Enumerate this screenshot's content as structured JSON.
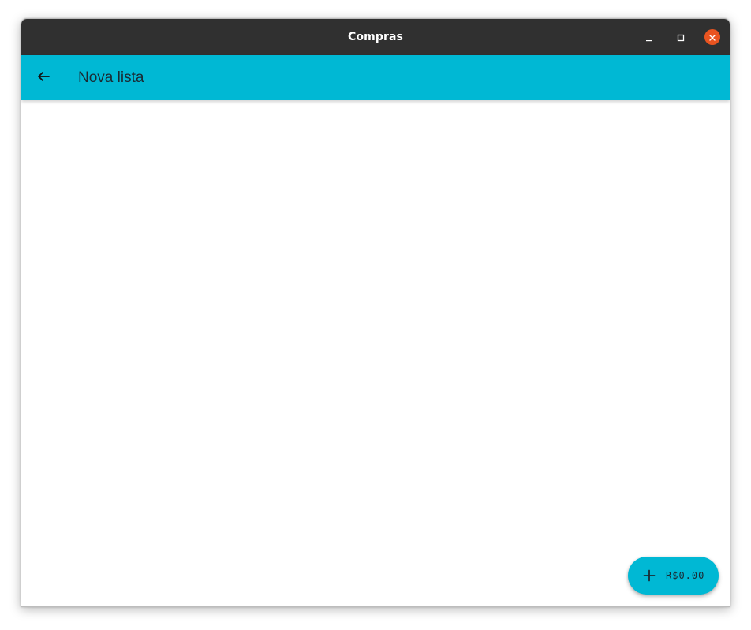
{
  "window": {
    "title": "Compras"
  },
  "appbar": {
    "title": "Nova lista",
    "back_icon": "arrow-back-icon"
  },
  "window_controls": {
    "minimize_icon": "minimize-icon",
    "maximize_icon": "maximize-icon",
    "close_icon": "close-icon"
  },
  "fab": {
    "icon": "plus-icon",
    "label": "R$0.00"
  },
  "colors": {
    "titlebar": "#303030",
    "accent": "#00b8d4",
    "close_button": "#e95420"
  }
}
